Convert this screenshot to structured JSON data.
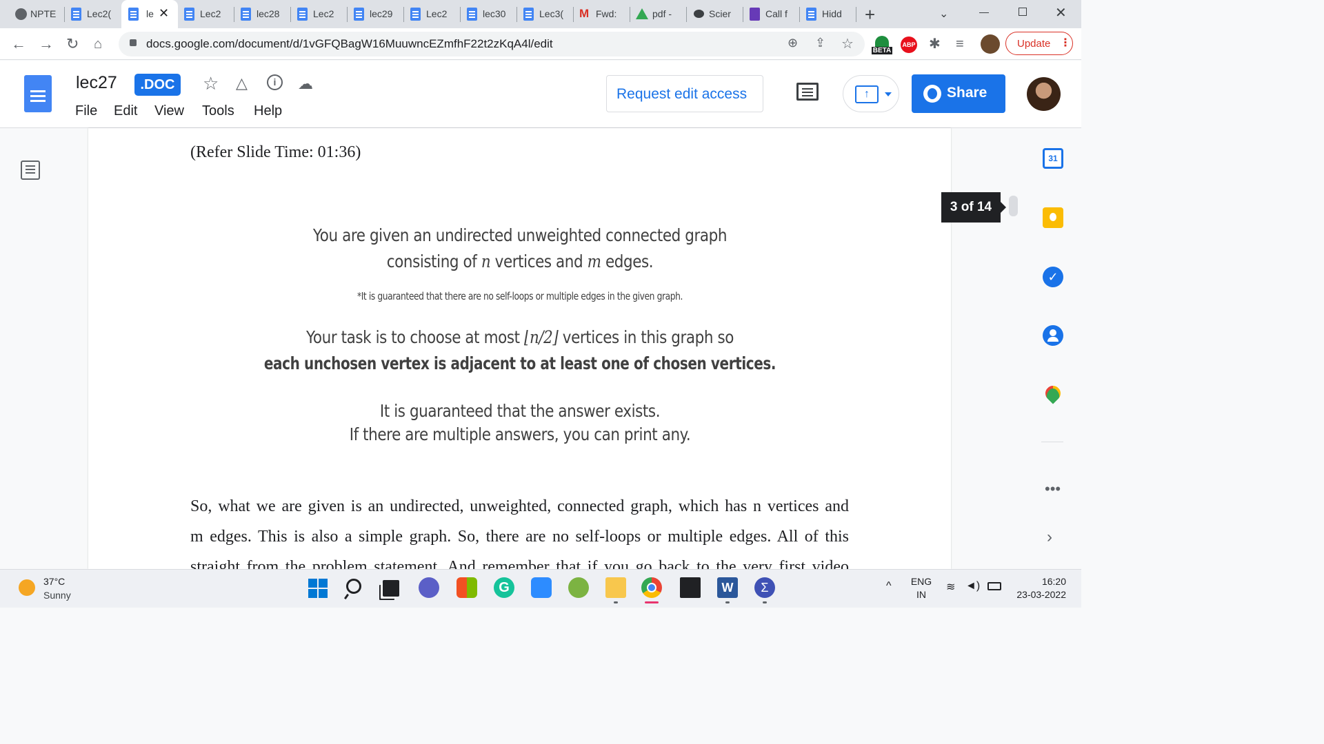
{
  "browser": {
    "tabs": [
      {
        "label": "NPTE",
        "icon": "globe-icon"
      },
      {
        "label": "Lec2(",
        "icon": "docs-icon"
      },
      {
        "label": "le",
        "icon": "docs-icon",
        "active": true
      },
      {
        "label": "Lec2",
        "icon": "docs-icon"
      },
      {
        "label": "lec28",
        "icon": "docs-icon"
      },
      {
        "label": "Lec2",
        "icon": "docs-icon"
      },
      {
        "label": "lec29",
        "icon": "docs-icon"
      },
      {
        "label": "Lec2",
        "icon": "docs-icon"
      },
      {
        "label": "lec30",
        "icon": "docs-icon"
      },
      {
        "label": "Lec3(",
        "icon": "docs-icon"
      },
      {
        "label": "Fwd:",
        "icon": "gmail-icon"
      },
      {
        "label": "pdf -",
        "icon": "drive-icon"
      },
      {
        "label": "Scier",
        "icon": "chat-icon"
      },
      {
        "label": "Call f",
        "icon": "forms-icon"
      },
      {
        "label": "Hidd",
        "icon": "docs-icon"
      }
    ],
    "new_tab": "+",
    "url": "docs.google.com/document/d/1vGFQBagW16MuuwncEZmfhF22t2zKqA4l/edit",
    "beta_badge": "BETA",
    "abp_badge": "ABP",
    "update_label": "Update"
  },
  "docs": {
    "title": "lec27",
    "format_badge": ".DOC",
    "menu": [
      "File",
      "Edit",
      "View",
      "Tools",
      "Help"
    ],
    "request_edit": "Request edit access",
    "share": "Share",
    "page_indicator": "3 of 14"
  },
  "document": {
    "refer": "(Refer Slide Time: 01:36)",
    "slide_line1": "You are given an undirected unweighted connected graph",
    "slide_line2_a": "consisting of ",
    "slide_line2_n": "n",
    "slide_line2_b": " vertices and ",
    "slide_line2_m": "m",
    "slide_line2_c": " edges.",
    "slide_note": "*It is guaranteed that there are no self-loops or multiple edges in the given graph.",
    "slide_task_a": "Your task is to choose at most ",
    "slide_task_floor": "⌊n/2⌋",
    "slide_task_b": " vertices in this graph so",
    "slide_task_bold": "each unchosen vertex is adjacent to at least one of chosen vertices.",
    "slide_exists": "It is guaranteed that the answer exists.",
    "slide_multiple": "If there are multiple answers, you can print any.",
    "para_line1": "So, what we are given is an undirected, unweighted, connected graph, which has n vertices and",
    "para_line2": "m edges. This is also a simple graph. So, there are no self-loops or multiple edges. All of this",
    "para_line3": "straight from the problem statement. And remember that if you go back to the very first video"
  },
  "taskbar": {
    "temp": "37°C",
    "weather": "Sunny",
    "lang1": "ENG",
    "lang2": "IN",
    "time": "16:20",
    "date": "23-03-2022"
  },
  "colors": {
    "google_blue": "#1a73e8",
    "docs_blue": "#4285f4",
    "tab_strip": "#dee1e6",
    "taskbar": "#eef0f4"
  }
}
